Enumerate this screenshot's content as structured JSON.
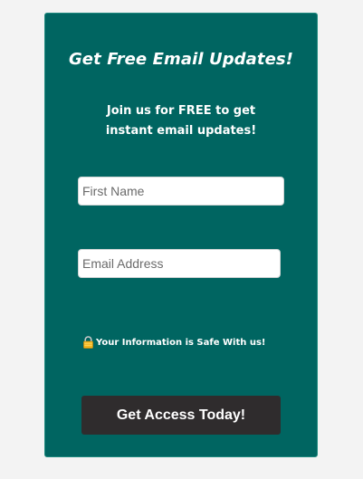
{
  "signup": {
    "title": "Get Free Email Updates!",
    "subtitle": "Join us for FREE to get instant email updates!",
    "first_name_placeholder": "First Name",
    "email_placeholder": "Email Address",
    "safe_note": "Your Information is Safe With us!",
    "submit_label": "Get Access Today!",
    "lock_icon": "lock-icon"
  },
  "colors": {
    "page_background": "#f3f3f3",
    "card_background": "#006561",
    "button_background": "#2f2c2d",
    "text": "#ffffff"
  }
}
